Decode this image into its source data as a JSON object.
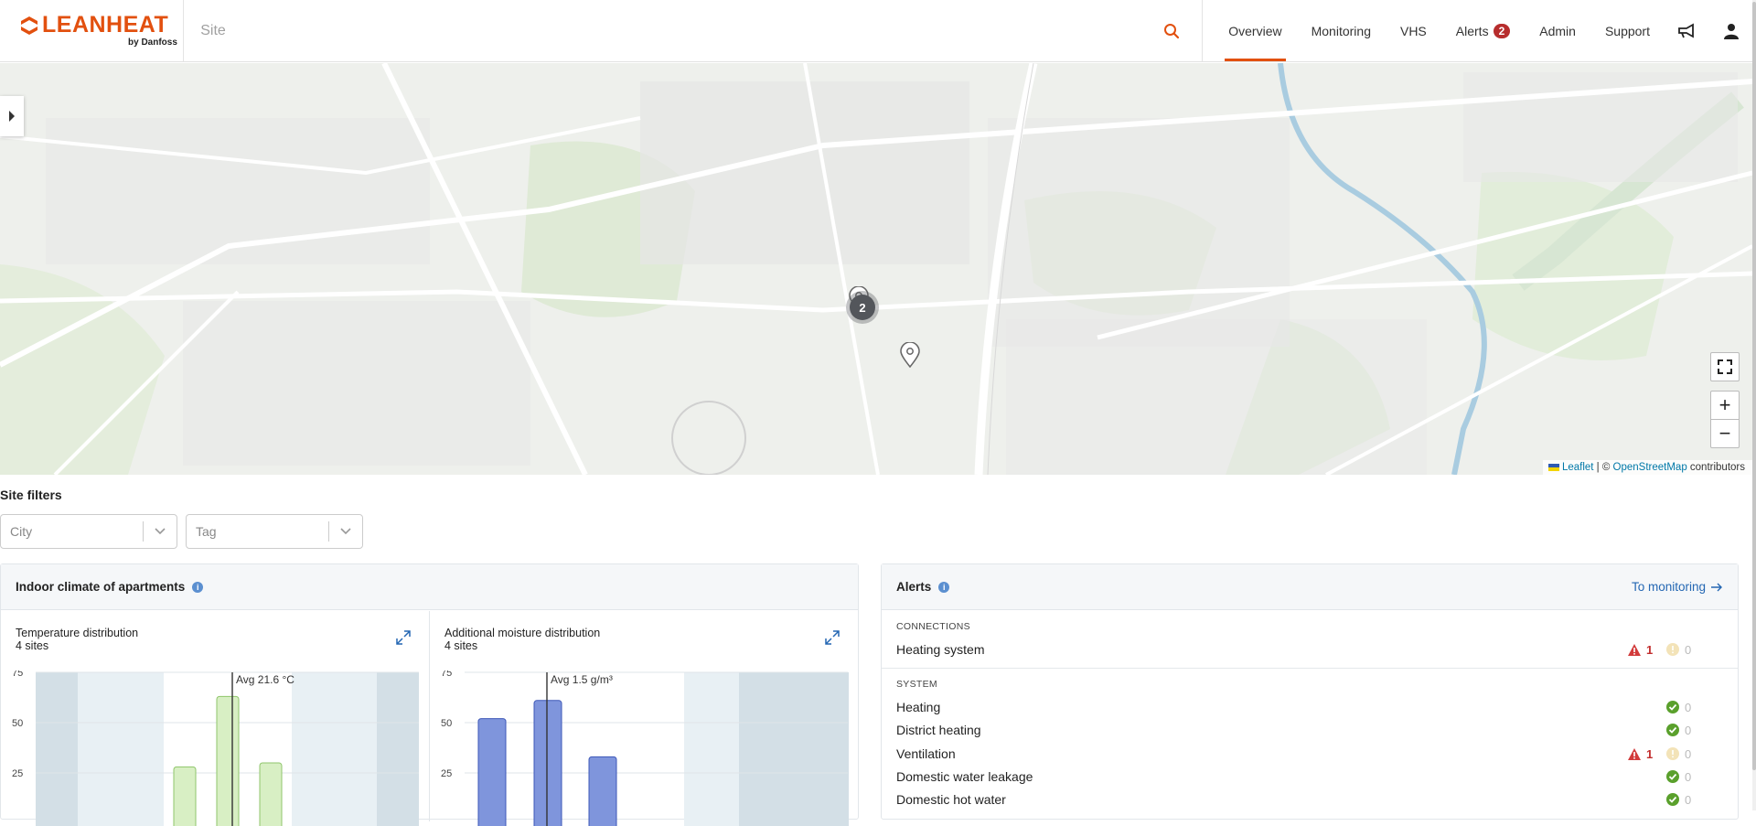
{
  "app": {
    "logo_text": "LEANHEAT",
    "logo_sub": "by Danfoss"
  },
  "search": {
    "placeholder": "Site"
  },
  "nav": {
    "overview": "Overview",
    "monitoring": "Monitoring",
    "vhs": "VHS",
    "alerts": "Alerts",
    "alerts_badge": "2",
    "admin": "Admin",
    "support": "Support"
  },
  "map": {
    "cluster_count": "2",
    "zoom_in": "+",
    "zoom_out": "−",
    "attribution_leaflet": "Leaflet",
    "attribution_sep": " | © ",
    "attribution_osm": "OpenStreetMap",
    "attribution_tail": " contributors"
  },
  "filters": {
    "title": "Site filters",
    "city_placeholder": "City",
    "tag_placeholder": "Tag"
  },
  "indoor": {
    "title": "Indoor climate of apartments",
    "temp_title": "Temperature distribution",
    "temp_sub": "4 sites",
    "temp_avg": "Avg 21.6 °C",
    "moist_title": "Additional moisture distribution",
    "moist_sub": "4 sites",
    "moist_avg": "Avg 1.5 g/m³"
  },
  "chart_data": [
    {
      "type": "bar",
      "title": "Temperature distribution",
      "ylim": [
        0,
        75
      ],
      "yticks": [
        75,
        50,
        25
      ],
      "values": [
        28,
        63,
        30
      ],
      "avg_label": "Avg 21.6 °C",
      "colors": {
        "bar": "#d8efc4",
        "bar_border": "#8fc66b"
      }
    },
    {
      "type": "bar",
      "title": "Additional moisture distribution",
      "ylim": [
        0,
        75
      ],
      "yticks": [
        75,
        50,
        25
      ],
      "values": [
        52,
        61,
        33
      ],
      "avg_label": "Avg 1.5 g/m³",
      "colors": {
        "bar": "#7f95dc",
        "bar_border": "#3e58b8"
      }
    }
  ],
  "alerts": {
    "title": "Alerts",
    "link": "To monitoring",
    "connections_label": "CONNECTIONS",
    "system_label": "SYSTEM",
    "connections": [
      {
        "name": "Heating system",
        "red": "1",
        "warn": "0"
      }
    ],
    "system": [
      {
        "name": "Heating",
        "red": "",
        "ok": "0"
      },
      {
        "name": "District heating",
        "red": "",
        "ok": "0"
      },
      {
        "name": "Ventilation",
        "red": "1",
        "warn": "0"
      },
      {
        "name": "Domestic water leakage",
        "red": "",
        "ok": "0"
      },
      {
        "name": "Domestic hot water",
        "red": "",
        "ok": "0"
      }
    ]
  },
  "colors": {
    "accent": "#e2500f",
    "badge": "#b72d2d",
    "link": "#2467b3",
    "ok": "#5aa02c",
    "error": "#d23b3b"
  }
}
